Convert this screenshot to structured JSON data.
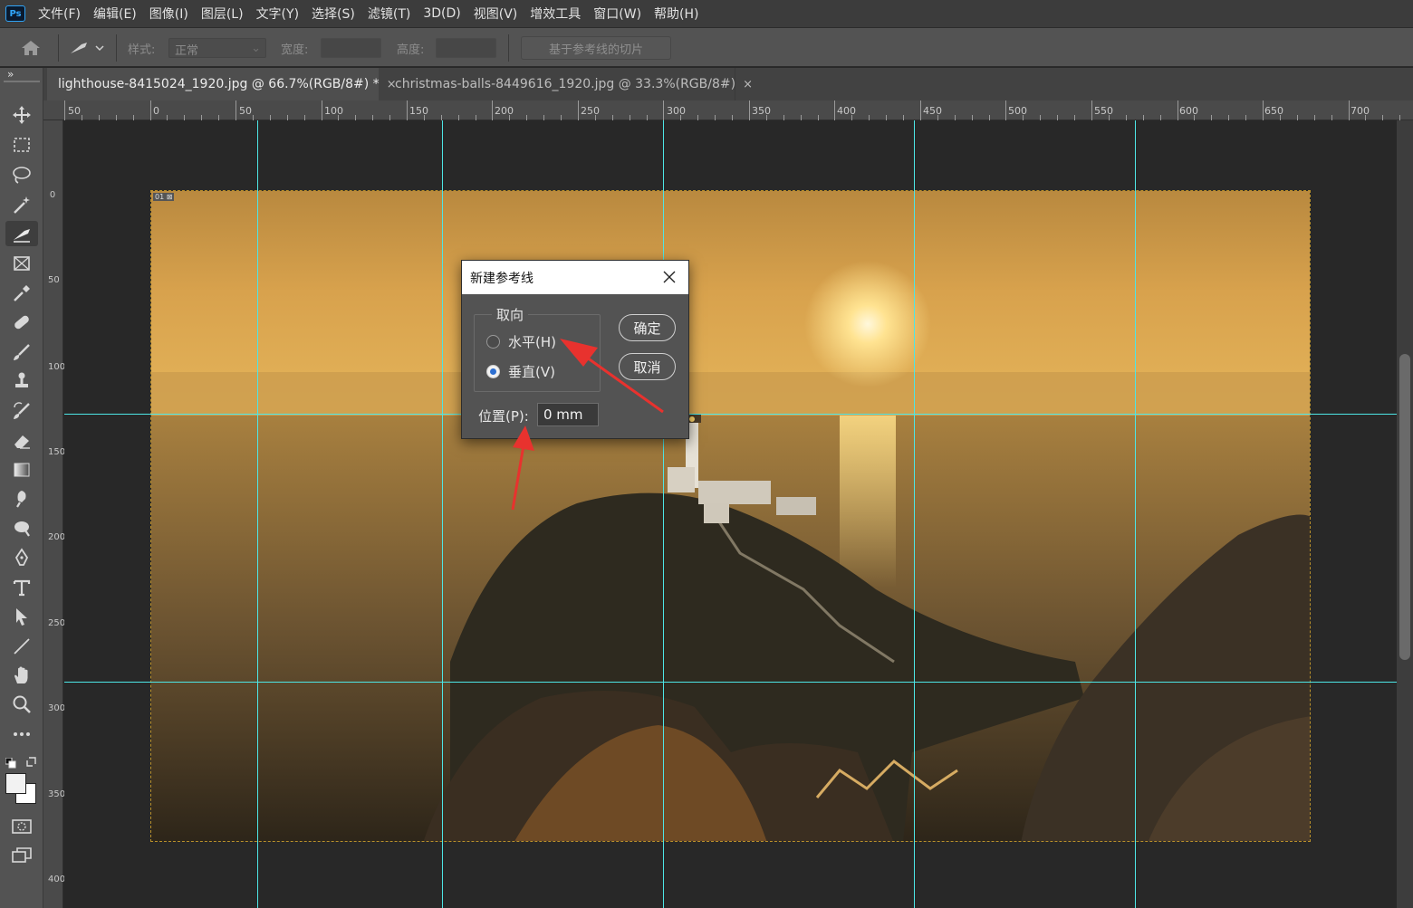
{
  "app": {
    "logo_text": "Ps",
    "menu": [
      "文件(F)",
      "编辑(E)",
      "图像(I)",
      "图层(L)",
      "文字(Y)",
      "选择(S)",
      "滤镜(T)",
      "3D(D)",
      "视图(V)",
      "增效工具",
      "窗口(W)",
      "帮助(H)"
    ]
  },
  "options_bar": {
    "style_label": "样式:",
    "style_value": "正常",
    "width_label": "宽度:",
    "height_label": "高度:",
    "slice_button": "基于参考线的切片"
  },
  "tabs": [
    {
      "label": "lighthouse-8415024_1920.jpg @ 66.7%(RGB/8#) *",
      "close": "×",
      "active": true
    },
    {
      "label": "christmas-balls-8449616_1920.jpg @ 33.3%(RGB/8#)",
      "close": "×",
      "active": false
    }
  ],
  "toolbar": {
    "collapse": "»",
    "tools": [
      "move-tool-icon",
      "rect-marquee-icon",
      "lasso-icon",
      "magic-wand-icon",
      "slice-tool-icon",
      "frame-tool-icon",
      "eyedropper-icon",
      "healing-brush-icon",
      "brush-icon",
      "clone-stamp-icon",
      "history-brush-icon",
      "eraser-icon",
      "gradient-icon",
      "smudge-icon",
      "dodge-icon",
      "pen-icon",
      "type-icon",
      "path-select-icon",
      "line-icon",
      "hand-icon",
      "zoom-icon",
      "more-tools-icon"
    ],
    "active_tool": "slice-tool-icon"
  },
  "ruler_top": [
    "50",
    "0",
    "50",
    "100",
    "150",
    "200",
    "250",
    "300",
    "350",
    "400",
    "450",
    "500",
    "550",
    "600",
    "650",
    "700"
  ],
  "ruler_left": [
    "0",
    "50",
    "100",
    "150",
    "200",
    "250",
    "300",
    "350",
    "400"
  ],
  "dialog": {
    "title": "新建参考线",
    "group_label": "取向",
    "option_horizontal": "水平(H)",
    "option_vertical": "垂直(V)",
    "selected": "vertical",
    "ok": "确定",
    "cancel": "取消",
    "position_label": "位置(P):",
    "position_value": "0 mm"
  },
  "colors": {
    "guide": "#4de6e6",
    "annotation_arrow": "#e8322e",
    "accent": "#31a8ff"
  }
}
